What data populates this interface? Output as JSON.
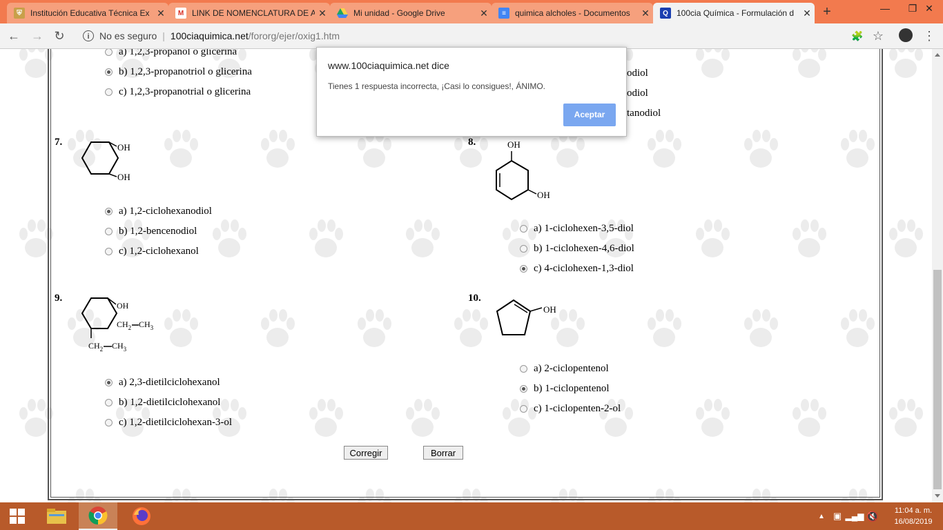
{
  "browser": {
    "tabs": [
      {
        "title": "Institución Educativa Técnica Ex",
        "icon": "crest-icon",
        "active": false
      },
      {
        "title": "LINK DE NOMENCLATURA DE A",
        "icon": "gmail-icon",
        "active": false
      },
      {
        "title": "Mi unidad - Google Drive",
        "icon": "drive-icon",
        "active": false
      },
      {
        "title": "quimica alcholes - Documentos",
        "icon": "docs-icon",
        "active": false
      },
      {
        "title": "100cia Química - Formulación d",
        "icon": "q-icon",
        "active": true
      }
    ],
    "security_label": "No es seguro",
    "url_host": "100ciaquimica.net",
    "url_path": "/fororg/ejer/oxig1.htm"
  },
  "dialog": {
    "title": "www.100ciaquimica.net dice",
    "message": "Tienes 1 respuesta incorrecta, ¡Casi lo consigues!, ÁNIMO.",
    "button": "Aceptar"
  },
  "questions": {
    "q6": {
      "options": [
        {
          "text": "a) 1,2,3-propanol o glicerina",
          "selected": false
        },
        {
          "text": "b) 1,2,3-propanotriol o glicerina",
          "selected": true
        },
        {
          "text": "c) 1,2,3-propanotrial o glicerina",
          "selected": false
        }
      ]
    },
    "q_right_top": {
      "fragments": [
        "odiol",
        "odiol",
        "tanodiol"
      ]
    },
    "q7": {
      "number": "7.",
      "labels": {
        "oh1": "OH",
        "oh2": "OH"
      },
      "options": [
        {
          "text": "a) 1,2-ciclohexanodiol",
          "selected": true
        },
        {
          "text": "b) 1,2-bencenodiol",
          "selected": false
        },
        {
          "text": "c) 1,2-ciclohexanol",
          "selected": false
        }
      ]
    },
    "q8": {
      "number": "8.",
      "labels": {
        "oh1": "OH",
        "oh2": "OH"
      },
      "options": [
        {
          "text": "a) 1-ciclohexen-3,5-diol",
          "selected": false
        },
        {
          "text": "b) 1-ciclohexen-4,6-diol",
          "selected": false
        },
        {
          "text": "c) 4-ciclohexen-1,3-diol",
          "selected": true
        }
      ]
    },
    "q9": {
      "number": "9.",
      "labels": {
        "oh": "OH",
        "ch2a": "CH",
        "sub2a": "2",
        "ch3a": "CH",
        "sub3a": "3",
        "ch2b": "CH",
        "sub2b": "2",
        "ch3b": "CH",
        "sub3b": "3"
      },
      "options": [
        {
          "text": "a) 2,3-dietilciclohexanol",
          "selected": true
        },
        {
          "text": "b) 1,2-dietilciclohexanol",
          "selected": false
        },
        {
          "text": "c) 1,2-dietilciclohexan-3-ol",
          "selected": false
        }
      ]
    },
    "q10": {
      "number": "10.",
      "labels": {
        "oh": "OH"
      },
      "options": [
        {
          "text": "a) 2-ciclopentenol",
          "selected": false
        },
        {
          "text": "b) 1-ciclopentenol",
          "selected": true
        },
        {
          "text": "c) 1-ciclopenten-2-ol",
          "selected": false
        }
      ]
    }
  },
  "actions": {
    "check": "Corregir",
    "clear": "Borrar"
  },
  "taskbar": {
    "time": "11:04 a. m.",
    "date": "16/08/2019"
  },
  "colors": {
    "tabstrip": "#f27a4e",
    "taskbar": "#b85a2a",
    "dialog_button": "#7aa7f0"
  }
}
